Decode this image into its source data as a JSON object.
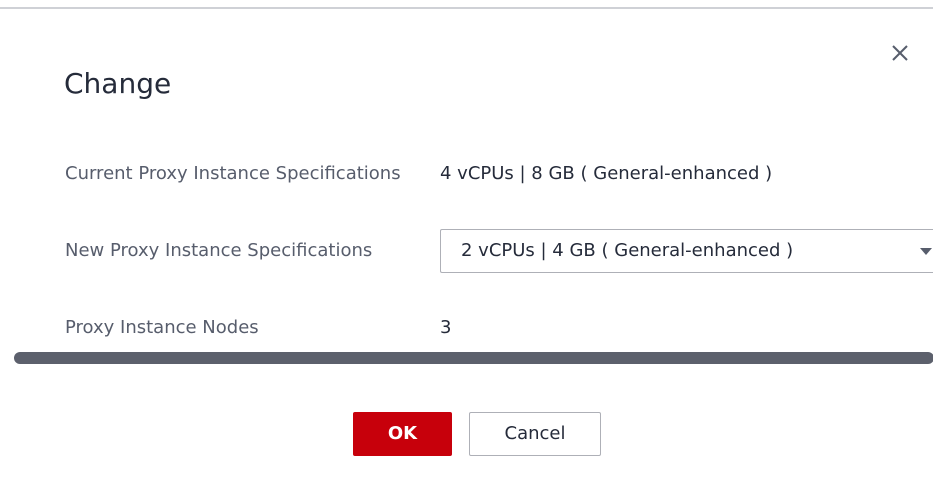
{
  "dialog": {
    "title": "Change",
    "close_icon": "close-icon"
  },
  "fields": {
    "current_spec": {
      "label": "Current Proxy Instance Specifications",
      "value": "4 vCPUs | 8 GB ( General-enhanced )"
    },
    "new_spec": {
      "label": "New Proxy Instance Specifications",
      "selected": "2 vCPUs | 4 GB ( General-enhanced )",
      "caret_icon": "caret-down-icon"
    },
    "nodes": {
      "label": "Proxy Instance Nodes",
      "value": "3"
    }
  },
  "footer": {
    "ok_label": "OK",
    "cancel_label": "Cancel"
  },
  "colors": {
    "primary": "#c7000b",
    "text": "#252b3a",
    "label": "#575d6c",
    "scrollbar": "#5c606c"
  }
}
